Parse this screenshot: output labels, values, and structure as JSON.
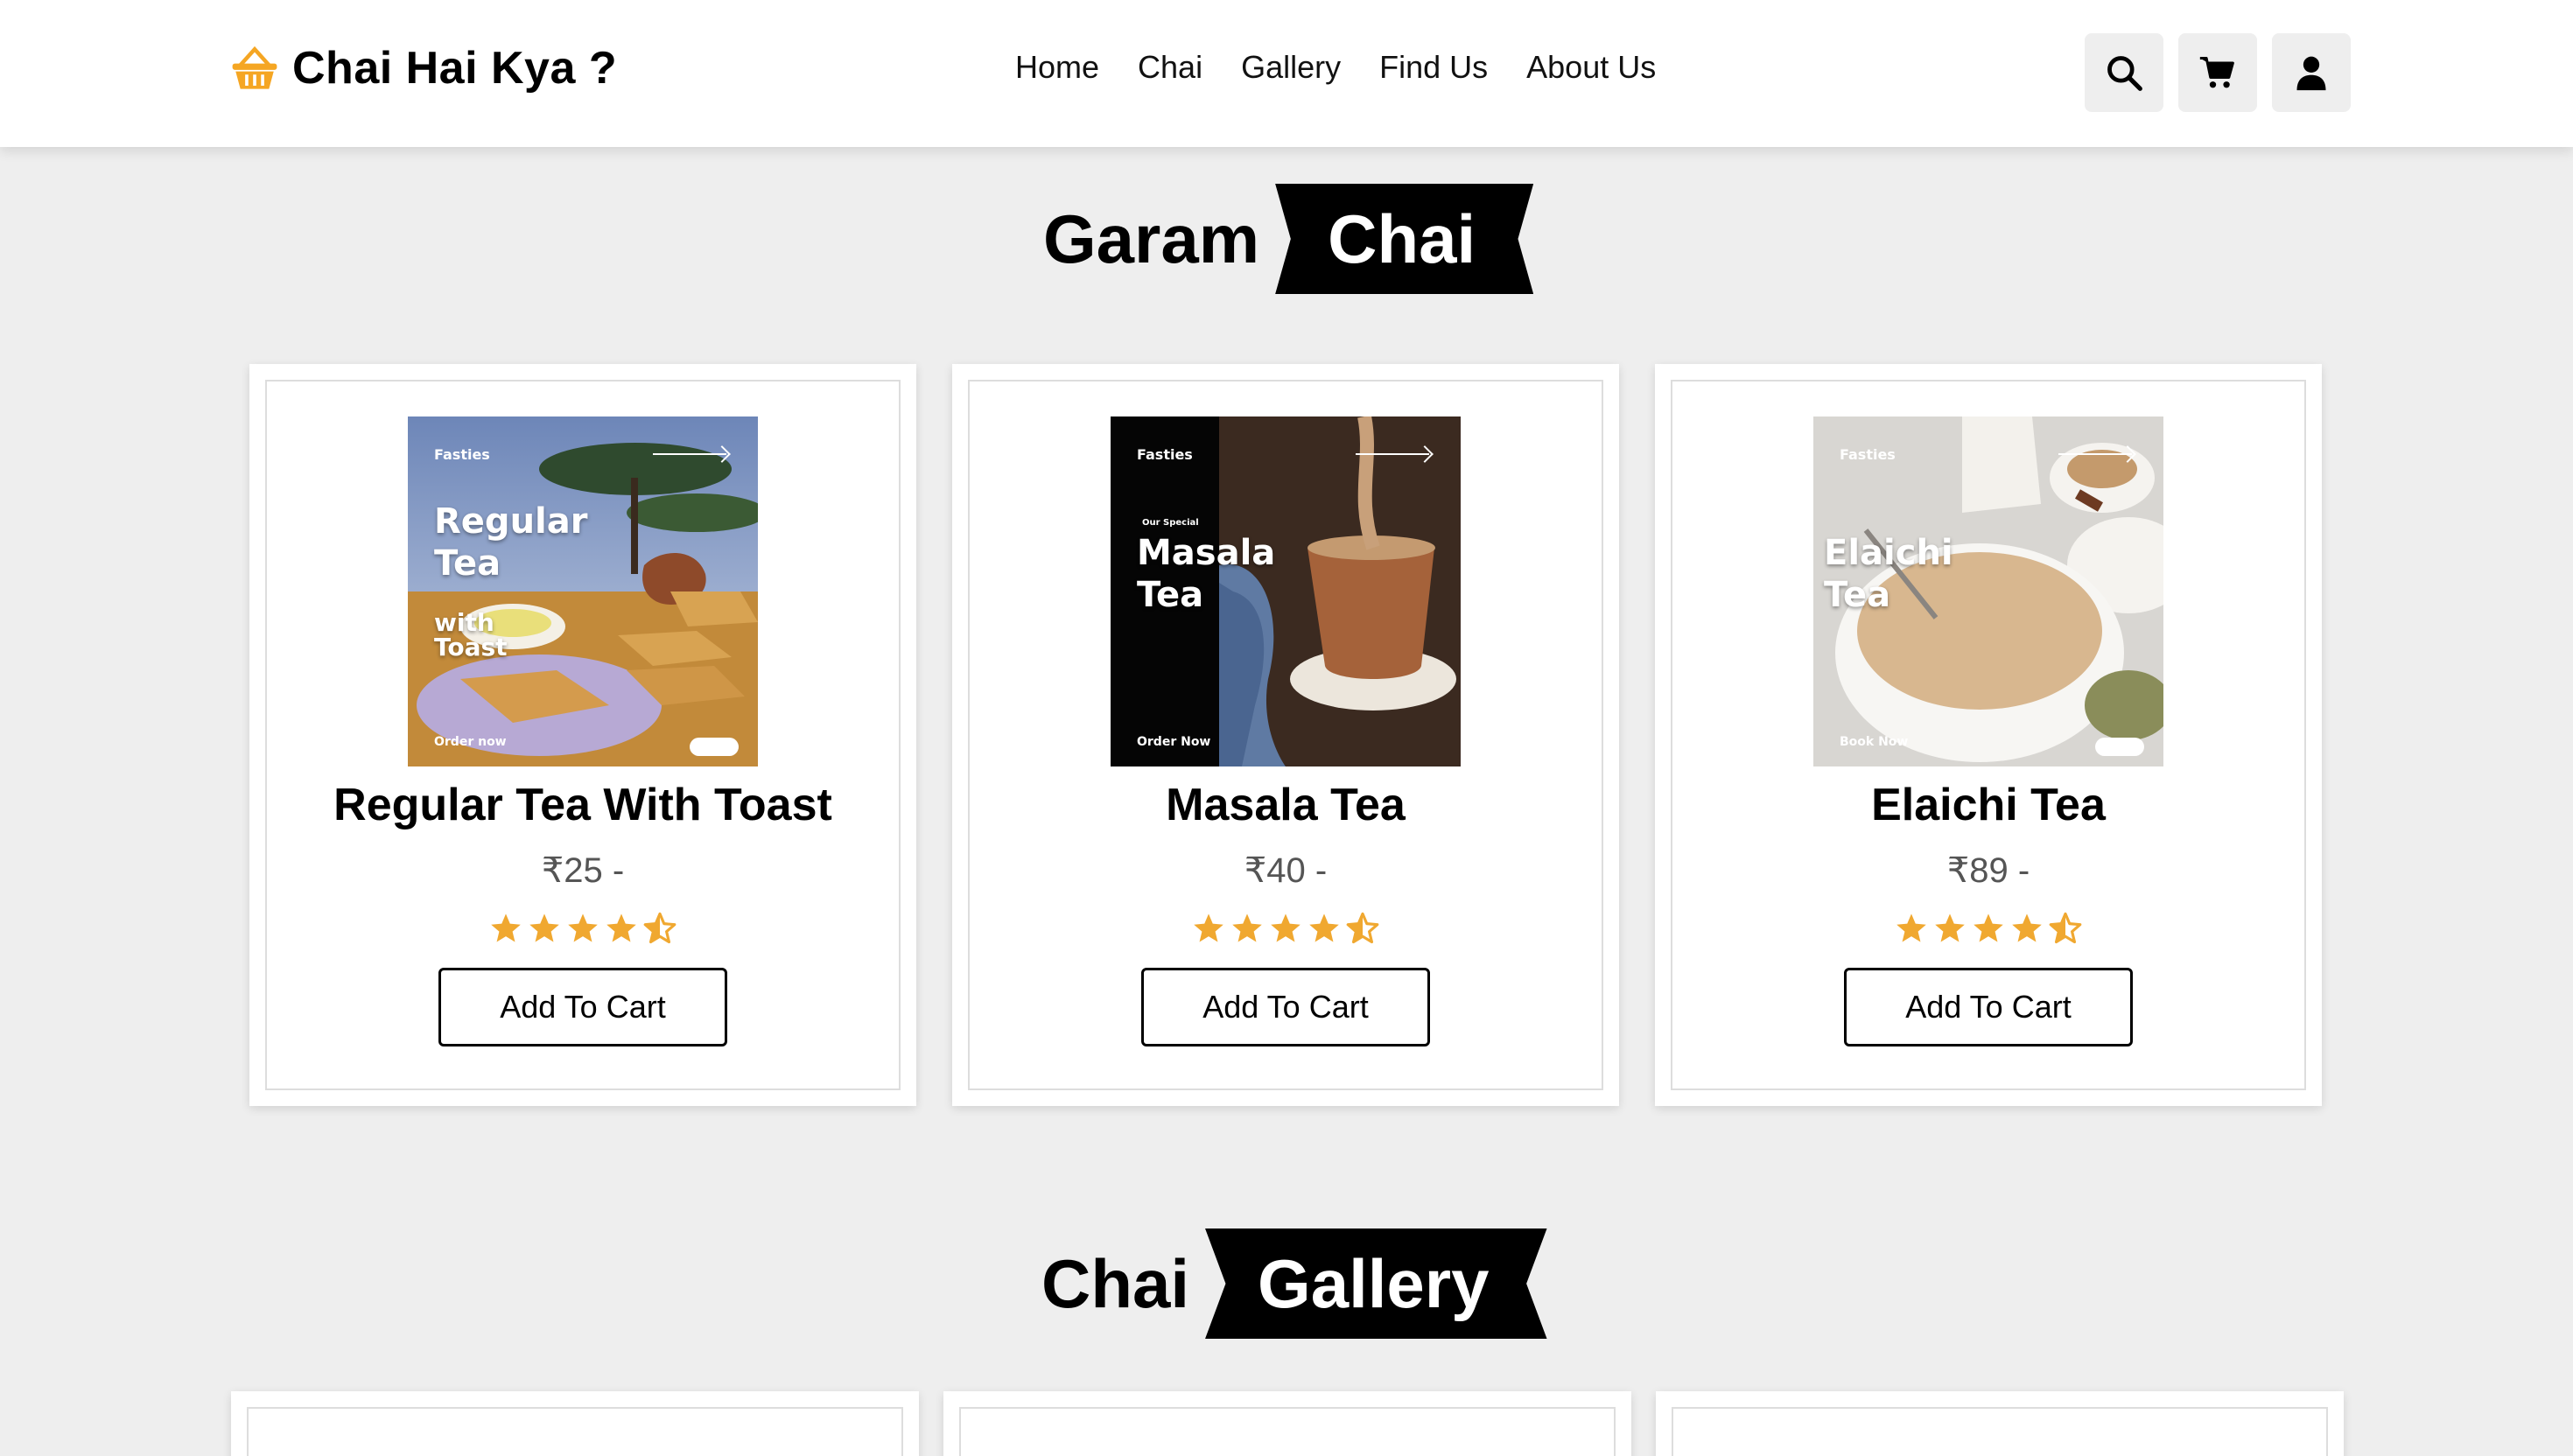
{
  "header": {
    "logo_text": "Chai Hai Kya ?",
    "nav": [
      "Home",
      "Chai",
      "Gallery",
      "Find Us",
      "About Us"
    ],
    "icons": [
      "search-icon",
      "cart-icon",
      "user-icon"
    ]
  },
  "section1": {
    "word": "Garam",
    "ribbon": "Chai"
  },
  "products": [
    {
      "name": "Regular Tea With Toast",
      "price": "₹25 -",
      "rating": 4.5,
      "button": "Add To Cart",
      "image": {
        "brand": "Fasties",
        "title": "Regular\nTea",
        "sub": "with\nToast",
        "cta": "Order now",
        "swipe": "swipe"
      }
    },
    {
      "name": "Masala Tea",
      "price": "₹40 -",
      "rating": 4.5,
      "button": "Add To Cart",
      "image": {
        "brand": "Fasties",
        "special": "Our Special",
        "title": "Masala\nTea",
        "cta": "Order Now"
      }
    },
    {
      "name": "Elaichi Tea",
      "price": "₹89 -",
      "rating": 4.5,
      "button": "Add To Cart",
      "image": {
        "brand": "Fasties",
        "title": "Elaichi\nTea",
        "cta": "Book Now",
        "swipe": "swipe"
      }
    }
  ],
  "section2": {
    "word": "Chai",
    "ribbon": "Gallery"
  },
  "colors": {
    "star": "#f0a830",
    "ribbon": "#000000",
    "page_bg": "#eeeeee",
    "basket": "#f5a623"
  }
}
